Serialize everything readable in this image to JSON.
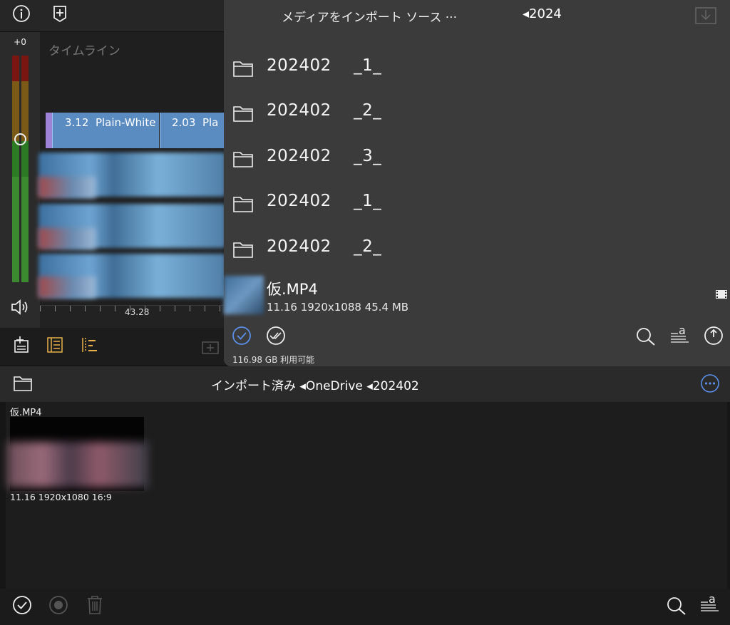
{
  "timeline": {
    "meter_label": "+0",
    "title": "タイムライン",
    "clips": [
      {
        "duration": "3.12",
        "name": "Plain-White"
      },
      {
        "duration": "2.03",
        "name": "Pla"
      }
    ],
    "ruler_value": "43.28"
  },
  "import_source": {
    "title": "メディアをインポート ソース ···",
    "path": "◂2024",
    "folders": [
      {
        "name": "202402",
        "suffix": "_1_"
      },
      {
        "name": "202402",
        "suffix": "_2_"
      },
      {
        "name": "202402",
        "suffix": "_3_"
      },
      {
        "name": "202402",
        "suffix": "_1_"
      },
      {
        "name": "202402",
        "suffix": "_2_"
      }
    ],
    "file": {
      "name": "仮.MP4",
      "meta": "11.16  1920x1088  45.4 MB"
    },
    "storage": "116.98 GB 利用可能"
  },
  "imported": {
    "title": "インポート済み ◂OneDrive ◂202402",
    "file": {
      "name": "仮.MP4",
      "meta": "11.16  1920x1080  16:9"
    }
  },
  "colors": {
    "accent": "#5b8ee8",
    "clip_blue": "#5a8cc2",
    "clip_handle": "#9d82d8",
    "panel": "#3b3b3b"
  }
}
